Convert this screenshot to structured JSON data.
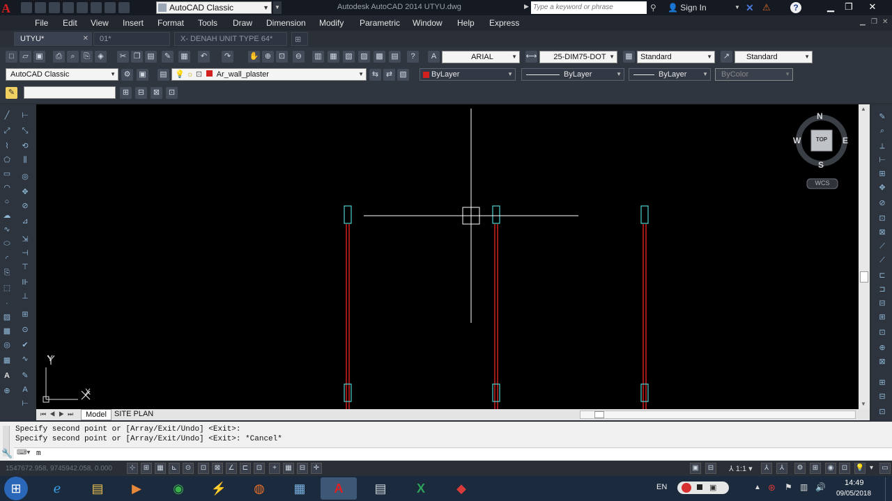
{
  "window": {
    "app_title": "Autodesk AutoCAD 2014    UTYU.dwg",
    "workspace": "AutoCAD Classic",
    "search_placeholder": "Type a keyword or phrase",
    "sign_in": "Sign In",
    "help": "?"
  },
  "menus": [
    "File",
    "Edit",
    "View",
    "Insert",
    "Format",
    "Tools",
    "Draw",
    "Dimension",
    "Modify",
    "Parametric",
    "Window",
    "Help",
    "Express"
  ],
  "tabs": [
    {
      "label": "UTYU*",
      "active": true
    },
    {
      "label": "01*",
      "active": false
    },
    {
      "label": "X- DENAH UNIT TYPE 64*",
      "active": false
    }
  ],
  "toolbar": {
    "text_font": "ARIAL",
    "dim_style": "25-DIM75-DOT",
    "table_style": "Standard",
    "mleader_style": "Standard",
    "workspace_combo": "AutoCAD Classic",
    "layer": "Ar_wall_plaster",
    "color": "ByLayer",
    "linetype": "ByLayer",
    "lineweight": "ByLayer",
    "plotstyle": "ByColor",
    "layer_color": "#d21f1f"
  },
  "viewcube": {
    "north": "N",
    "south": "S",
    "east": "E",
    "west": "W",
    "face": "TOP",
    "ucs": "WCS"
  },
  "ucs_icon": {
    "x": "X",
    "y": "Y"
  },
  "layout_tabs": [
    "Model",
    "SITE PLAN"
  ],
  "command": {
    "history": [
      "Specify second point or [Array/Exit/Undo] <Exit>:",
      "Specify second point or [Array/Exit/Undo] <Exit>: *Cancel*"
    ],
    "input": "m"
  },
  "status": {
    "coordinates": "1547672.958, 9745942.058, 0.000",
    "annotation_scale": "1:1"
  },
  "taskbar": {
    "language": "EN",
    "time": "14:49",
    "date": "09/05/2018",
    "apps": [
      "Start",
      "Internet Explorer",
      "File Explorer",
      "Media Player",
      "Chrome",
      "Power Tool",
      "Firefox",
      "Control Panel",
      "AutoCAD",
      "Calculator",
      "Excel",
      "SketchUp"
    ]
  },
  "colors": {
    "canvas": "#000000",
    "wall_line": "#d21f1f",
    "column_outline": "#4fd0d0",
    "crosshair": "#ffffff"
  }
}
